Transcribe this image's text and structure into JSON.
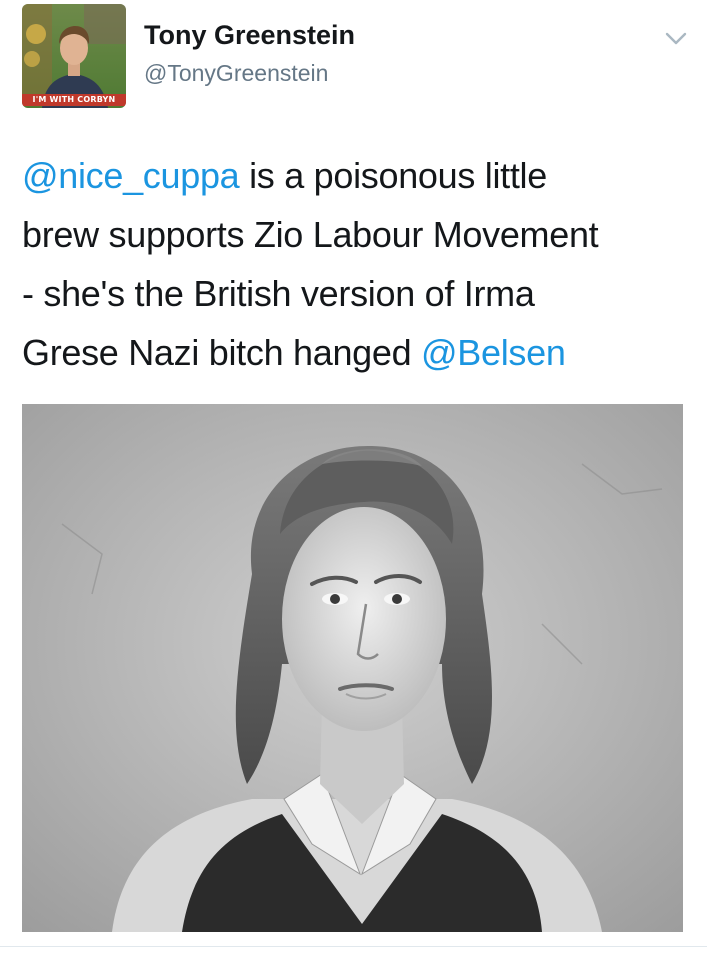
{
  "tweet": {
    "author_name": "Tony Greenstein",
    "author_handle": "@TonyGreenstein",
    "avatar_banner": "I'M WITH CORBYN",
    "text_lines": [
      [
        {
          "text": "@nice_cuppa",
          "mention": true
        },
        {
          "text": " is a poisonous little",
          "mention": false
        }
      ],
      [
        {
          "text": "brew supports Zio Labour Movement",
          "mention": false
        }
      ],
      [
        {
          "text": "- she's the British version of Irma",
          "mention": false
        }
      ],
      [
        {
          "text": "Grese Nazi bitch hanged ",
          "mention": false
        },
        {
          "text": "@Belsen",
          "mention": true
        }
      ]
    ],
    "menu_icon": "chevron-down-icon",
    "media_subject": "black-and-white portrait photograph"
  },
  "colors": {
    "name": "#14171a",
    "handle": "#657786",
    "mention": "#1b95e0",
    "chevron": "#aab8c2",
    "banner_bg": "#c0392b",
    "divider": "#e1e8ed"
  }
}
